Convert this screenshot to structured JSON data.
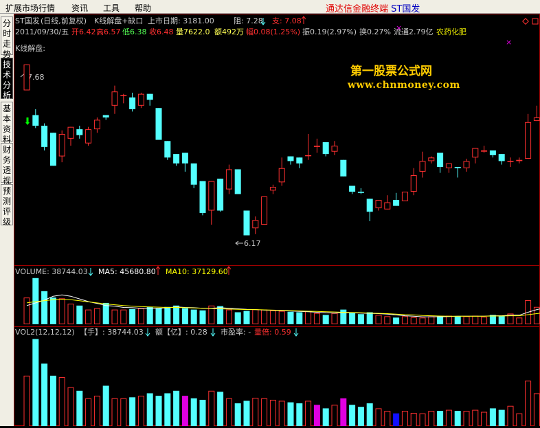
{
  "menu": {
    "items": [
      "扩展市场行情",
      "资讯",
      "工具",
      "帮助"
    ],
    "title_main": "通达信金融终端",
    "title_stock": "ST国发"
  },
  "sidebar": {
    "tabs": [
      {
        "label": "分时走势",
        "active": false
      },
      {
        "label": "技术分析",
        "active": true
      },
      {
        "label": "基本资料",
        "active": false
      },
      {
        "label": "财务透视",
        "active": false
      },
      {
        "label": "预测评级",
        "active": false
      }
    ]
  },
  "header": {
    "stock_name": "ST国发",
    "mode": "(日线,前复权)",
    "indicator": "K线解盘+缺口",
    "listing_label": "上市日期: 3181.00",
    "resistance_label": "阻: 7.28",
    "support_label": "支: 7.08",
    "date": "2011/09/30/五",
    "open": "开6.42",
    "high": "高6.57",
    "low": "低6.38",
    "close": "收6.48",
    "volume": "量7622.0",
    "amount": "额492万",
    "change": "幅0.08(1.25%)",
    "amplitude": "振0.19(2.97%)",
    "turnover": "换0.27%",
    "float_cap": "流通2.79亿",
    "sector": "农药化肥",
    "panel_label": "K线解盘:"
  },
  "watermark": {
    "line1": "第一股票公式网",
    "line2": "www.chnmoney.com"
  },
  "volume_panel": {
    "vol_label": "VOLUME: 38744.03",
    "ma5_label": "MA5: 45680.80",
    "ma10_label": "MA10: 37129.60"
  },
  "vol2_panel": {
    "name": "VOL2(12,12,12)",
    "hand_label": "【手】: 38744.03",
    "amount_label": "额【亿】: 0.28",
    "pe_label": "市盈率: -",
    "multiple_label": "量倍: 0.59"
  },
  "colors": {
    "up": "#ff3030",
    "down": "#54ffff",
    "highlight": "#e000e0",
    "special": "#1010ff",
    "grid": "#a00000",
    "ma5": "#ffffff",
    "ma10": "#ffff00"
  },
  "chart_data": {
    "type": "candlestick",
    "price_axis": [
      6.0,
      7.9
    ],
    "max_label": "7.68",
    "min_label": "6.17",
    "candles": [
      {
        "o": 7.46,
        "h": 7.68,
        "l": 7.46,
        "c": 7.68
      },
      {
        "o": 7.25,
        "h": 7.3,
        "l": 7.14,
        "c": 7.16
      },
      {
        "o": 7.16,
        "h": 7.18,
        "l": 6.95,
        "c": 6.98
      },
      {
        "o": 7.1,
        "h": 7.1,
        "l": 6.82,
        "c": 6.82
      },
      {
        "o": 6.9,
        "h": 7.12,
        "l": 6.85,
        "c": 7.09
      },
      {
        "o": 7.05,
        "h": 7.15,
        "l": 6.99,
        "c": 7.15
      },
      {
        "o": 7.13,
        "h": 7.16,
        "l": 7.05,
        "c": 7.08
      },
      {
        "o": 7.01,
        "h": 7.15,
        "l": 6.99,
        "c": 7.13
      },
      {
        "o": 7.13,
        "h": 7.23,
        "l": 7.1,
        "c": 7.21
      },
      {
        "o": 7.25,
        "h": 7.25,
        "l": 7.21,
        "c": 7.23
      },
      {
        "o": 7.33,
        "h": 7.5,
        "l": 7.26,
        "c": 7.45
      },
      {
        "o": 7.42,
        "h": 7.43,
        "l": 7.35,
        "c": 7.42
      },
      {
        "o": 7.4,
        "h": 7.44,
        "l": 7.28,
        "c": 7.3
      },
      {
        "o": 7.33,
        "h": 7.44,
        "l": 7.31,
        "c": 7.43
      },
      {
        "o": 7.43,
        "h": 7.43,
        "l": 7.33,
        "c": 7.38
      },
      {
        "o": 7.31,
        "h": 7.31,
        "l": 7.04,
        "c": 7.04
      },
      {
        "o": 7.03,
        "h": 7.03,
        "l": 6.87,
        "c": 6.89
      },
      {
        "o": 6.92,
        "h": 6.92,
        "l": 6.82,
        "c": 6.84
      },
      {
        "o": 6.93,
        "h": 6.93,
        "l": 6.77,
        "c": 6.84
      },
      {
        "o": 6.84,
        "h": 6.84,
        "l": 6.63,
        "c": 6.66
      },
      {
        "o": 6.69,
        "h": 6.69,
        "l": 6.4,
        "c": 6.42
      },
      {
        "o": 6.44,
        "h": 6.69,
        "l": 6.32,
        "c": 6.69
      },
      {
        "o": 6.71,
        "h": 6.71,
        "l": 6.43,
        "c": 6.44
      },
      {
        "o": 6.62,
        "h": 6.83,
        "l": 6.58,
        "c": 6.79
      },
      {
        "o": 6.79,
        "h": 6.79,
        "l": 6.58,
        "c": 6.58
      },
      {
        "o": 6.44,
        "h": 6.44,
        "l": 6.23,
        "c": 6.23
      },
      {
        "o": 6.29,
        "h": 6.39,
        "l": 6.24,
        "c": 6.36
      },
      {
        "o": 6.32,
        "h": 6.56,
        "l": 6.32,
        "c": 6.56
      },
      {
        "o": 6.61,
        "h": 6.66,
        "l": 6.58,
        "c": 6.64
      },
      {
        "o": 6.68,
        "h": 6.89,
        "l": 6.65,
        "c": 6.8
      },
      {
        "o": 6.9,
        "h": 6.9,
        "l": 6.83,
        "c": 6.86
      },
      {
        "o": 6.89,
        "h": 6.89,
        "l": 6.8,
        "c": 6.84
      },
      {
        "o": 6.91,
        "h": 7.09,
        "l": 6.87,
        "c": 6.91
      },
      {
        "o": 6.98,
        "h": 7.05,
        "l": 6.93,
        "c": 6.99
      },
      {
        "o": 7.02,
        "h": 7.02,
        "l": 6.9,
        "c": 6.92
      },
      {
        "o": 6.94,
        "h": 7.03,
        "l": 6.91,
        "c": 6.99
      },
      {
        "o": 6.87,
        "h": 6.87,
        "l": 6.73,
        "c": 6.73
      },
      {
        "o": 6.65,
        "h": 6.65,
        "l": 6.58,
        "c": 6.6
      },
      {
        "o": 6.6,
        "h": 6.63,
        "l": 6.58,
        "c": 6.59
      },
      {
        "o": 6.54,
        "h": 6.54,
        "l": 6.35,
        "c": 6.43
      },
      {
        "o": 6.46,
        "h": 6.53,
        "l": 6.44,
        "c": 6.53
      },
      {
        "o": 6.45,
        "h": 6.57,
        "l": 6.45,
        "c": 6.51
      },
      {
        "o": 6.53,
        "h": 6.59,
        "l": 6.48,
        "c": 6.48
      },
      {
        "o": 6.52,
        "h": 6.6,
        "l": 6.52,
        "c": 6.6
      },
      {
        "o": 6.6,
        "h": 6.8,
        "l": 6.57,
        "c": 6.74
      },
      {
        "o": 6.77,
        "h": 6.94,
        "l": 6.72,
        "c": 6.86
      },
      {
        "o": 6.86,
        "h": 6.9,
        "l": 6.84,
        "c": 6.89
      },
      {
        "o": 6.93,
        "h": 6.93,
        "l": 6.76,
        "c": 6.81
      },
      {
        "o": 6.8,
        "h": 6.84,
        "l": 6.76,
        "c": 6.84
      },
      {
        "o": 6.81,
        "h": 6.81,
        "l": 6.72,
        "c": 6.8
      },
      {
        "o": 6.8,
        "h": 6.88,
        "l": 6.77,
        "c": 6.86
      },
      {
        "o": 6.89,
        "h": 6.97,
        "l": 6.84,
        "c": 6.97
      },
      {
        "o": 6.94,
        "h": 6.99,
        "l": 6.93,
        "c": 6.95
      },
      {
        "o": 6.95,
        "h": 6.95,
        "l": 6.89,
        "c": 6.91
      },
      {
        "o": 6.92,
        "h": 6.92,
        "l": 6.83,
        "c": 6.86
      },
      {
        "o": 6.86,
        "h": 6.89,
        "l": 6.81,
        "c": 6.86
      },
      {
        "o": 6.86,
        "h": 6.89,
        "l": 6.84,
        "c": 6.87
      },
      {
        "o": 6.88,
        "h": 7.26,
        "l": 6.88,
        "c": 7.19
      },
      {
        "o": 7.2,
        "h": 7.33,
        "l": 7.2,
        "c": 7.23
      },
      {
        "o": 7.25,
        "h": 7.33,
        "l": 7.2,
        "c": 7.29
      }
    ],
    "volume": [
      1.0,
      1.73,
      1.24,
      1.0,
      0.97,
      0.77,
      0.7,
      0.55,
      0.6,
      0.8,
      0.55,
      0.55,
      0.57,
      0.6,
      0.65,
      0.6,
      0.65,
      0.7,
      0.6,
      0.55,
      0.52,
      0.7,
      0.68,
      0.55,
      0.45,
      0.5,
      0.56,
      0.55,
      0.52,
      0.5,
      0.47,
      0.45,
      0.5,
      0.42,
      0.35,
      0.42,
      0.55,
      0.42,
      0.38,
      0.45,
      0.35,
      0.3,
      0.25,
      0.3,
      0.26,
      0.25,
      0.3,
      0.3,
      0.32,
      0.3,
      0.3,
      0.32,
      0.28,
      0.35,
      0.32,
      0.4,
      0.25,
      0.9,
      0.65,
      0.55
    ],
    "ma5": [
      0.7,
      0.8,
      0.9,
      1.05,
      1.1,
      1.05,
      0.95,
      0.85,
      0.78,
      0.7,
      0.68,
      0.63,
      0.62,
      0.6,
      0.6,
      0.6,
      0.62,
      0.65,
      0.63,
      0.62,
      0.6,
      0.6,
      0.62,
      0.6,
      0.58,
      0.56,
      0.55,
      0.53,
      0.52,
      0.51,
      0.5,
      0.48,
      0.47,
      0.45,
      0.43,
      0.42,
      0.44,
      0.43,
      0.42,
      0.41,
      0.4,
      0.38,
      0.35,
      0.32,
      0.3,
      0.28,
      0.28,
      0.28,
      0.29,
      0.3,
      0.3,
      0.3,
      0.3,
      0.32,
      0.32,
      0.34,
      0.34,
      0.45,
      0.55,
      0.62
    ],
    "ma10": [
      0.8,
      0.85,
      0.88,
      0.92,
      0.94,
      0.92,
      0.88,
      0.84,
      0.8,
      0.76,
      0.73,
      0.7,
      0.68,
      0.66,
      0.65,
      0.64,
      0.63,
      0.63,
      0.62,
      0.61,
      0.6,
      0.59,
      0.58,
      0.57,
      0.56,
      0.55,
      0.55,
      0.54,
      0.53,
      0.52,
      0.51,
      0.5,
      0.49,
      0.48,
      0.47,
      0.46,
      0.45,
      0.44,
      0.43,
      0.42,
      0.41,
      0.4,
      0.38,
      0.36,
      0.35,
      0.33,
      0.32,
      0.31,
      0.3,
      0.3,
      0.3,
      0.3,
      0.3,
      0.31,
      0.31,
      0.32,
      0.32,
      0.36,
      0.4,
      0.44
    ],
    "vol2_highlight": {
      "18": "#e000e0",
      "33": "#e000e0",
      "36": "#e000e0",
      "42": "#1010ff"
    }
  }
}
